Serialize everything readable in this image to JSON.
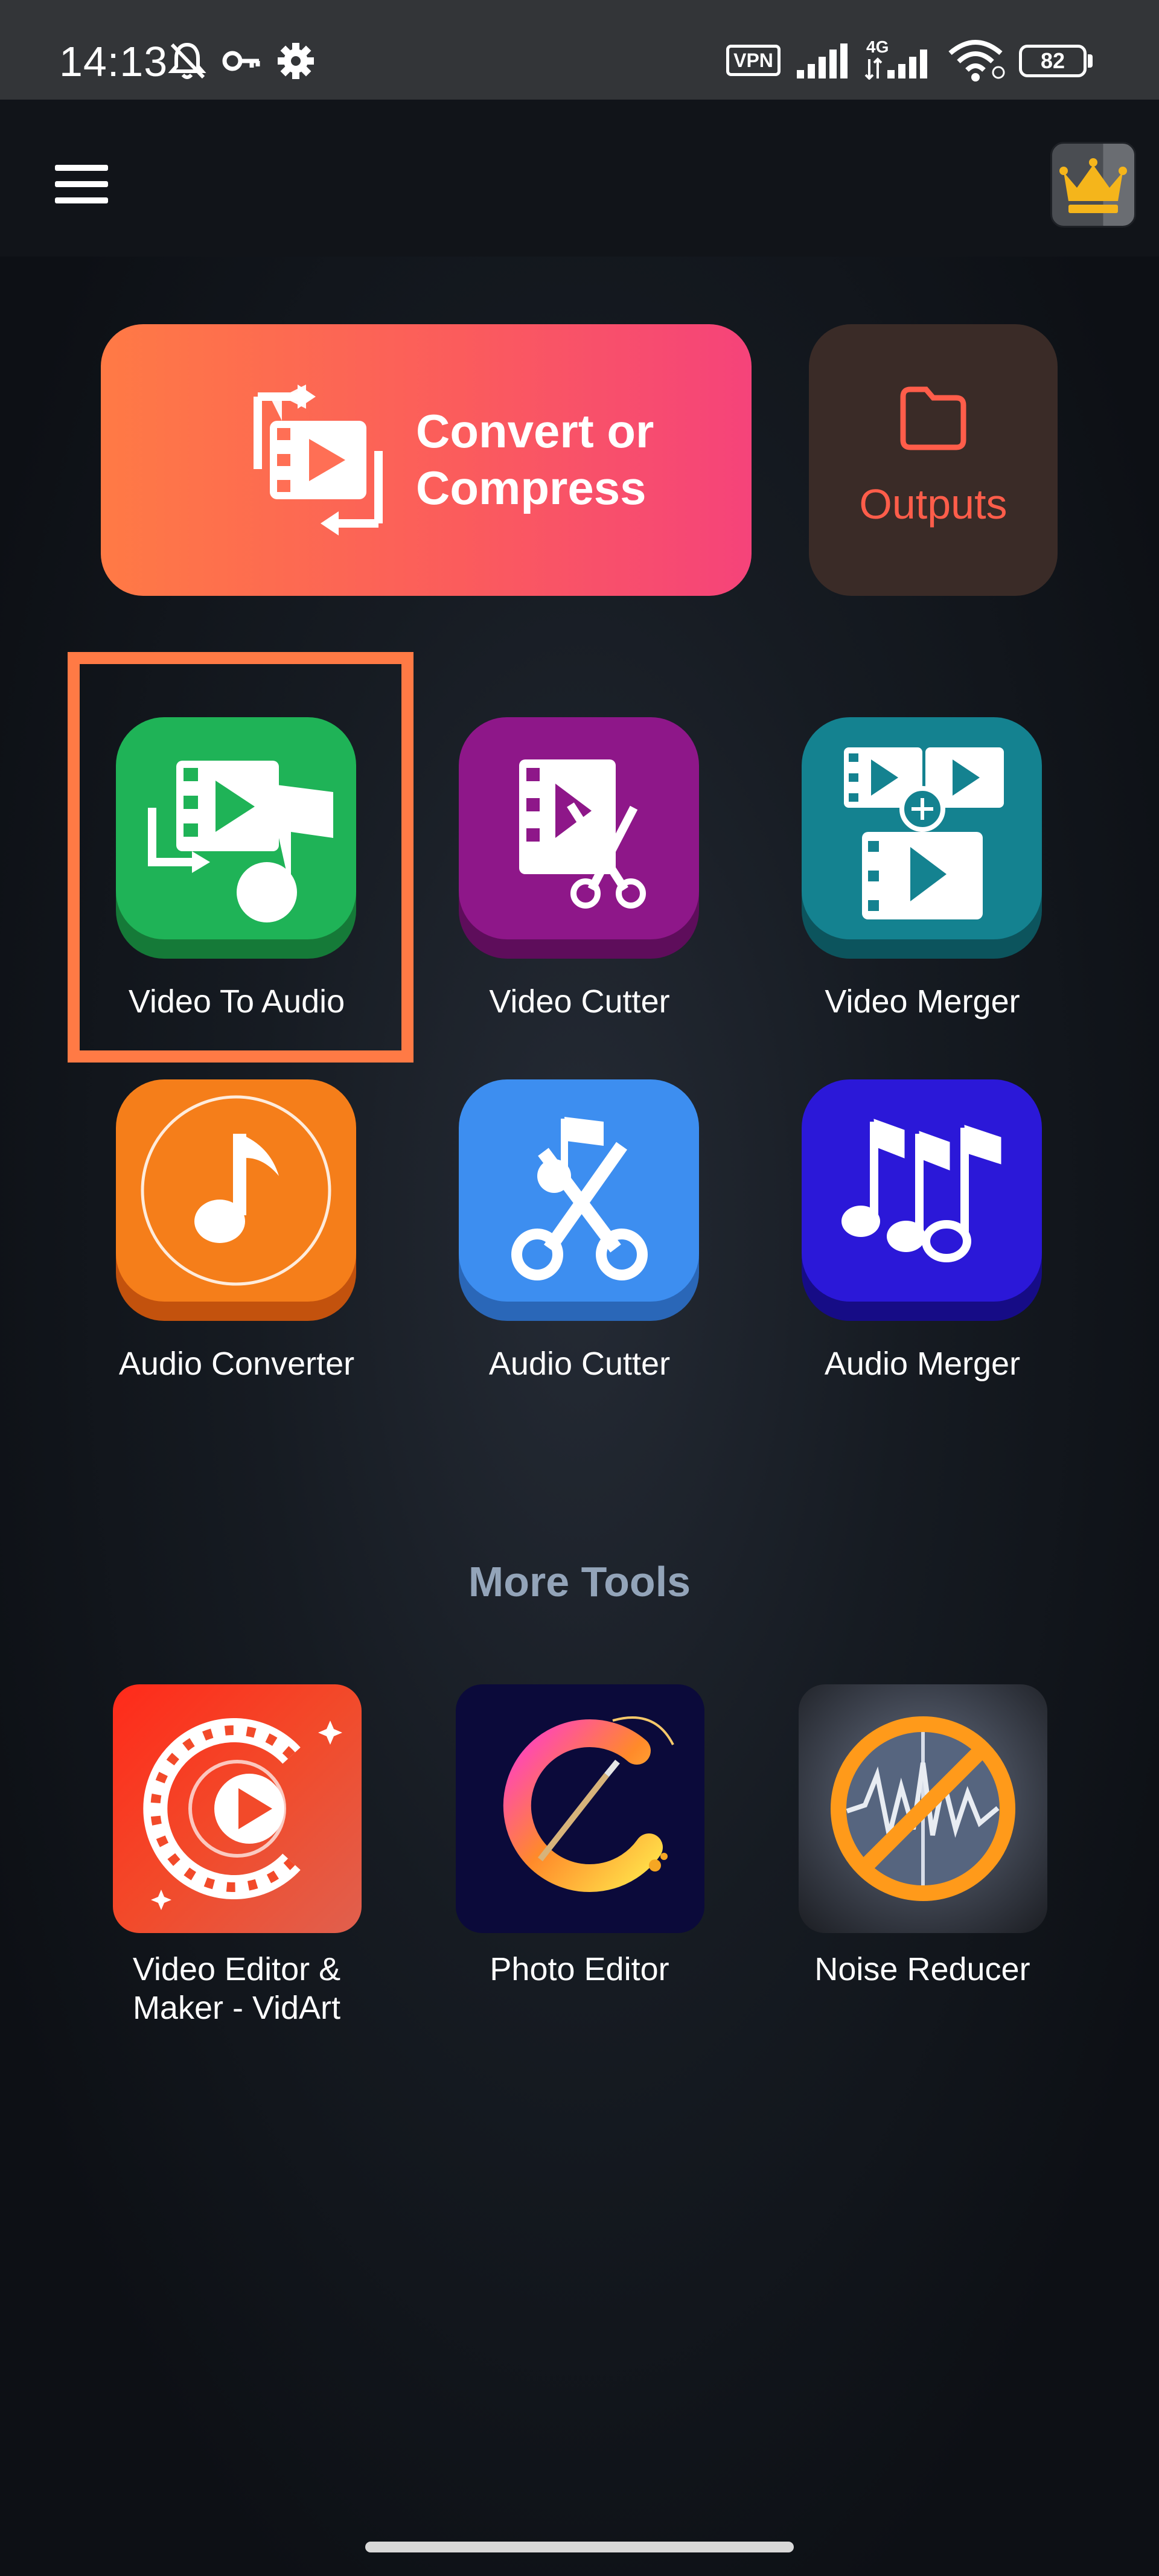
{
  "status_bar": {
    "time": "14:13",
    "vpn": "VPN",
    "network": "4G",
    "battery": "82"
  },
  "header": {
    "menu_icon": "hamburger-menu-icon",
    "premium_icon": "crown-icon"
  },
  "actions": {
    "convert_label_line1": "Convert or",
    "convert_label_line2": "Compress",
    "outputs_label": "Outputs"
  },
  "tools": [
    {
      "label": "Video To Audio",
      "icon": "video-to-audio-icon",
      "color": "#1fa84f",
      "highlighted": true
    },
    {
      "label": "Video Cutter",
      "icon": "video-cutter-icon",
      "color": "#8c1585"
    },
    {
      "label": "Video Merger",
      "icon": "video-merger-icon",
      "color": "#137d8a"
    },
    {
      "label": "Audio Converter",
      "icon": "audio-converter-icon",
      "color": "#f57c17"
    },
    {
      "label": "Audio Cutter",
      "icon": "audio-cutter-icon",
      "color": "#3d8ef0"
    },
    {
      "label": "Audio Merger",
      "icon": "audio-merger-icon",
      "color": "#2a17d6"
    }
  ],
  "more_tools": {
    "title": "More Tools",
    "items": [
      {
        "line1": "Video Editor &",
        "line2": "Maker - VidArt",
        "icon": "vidart-app-icon"
      },
      {
        "line1": "Photo Editor",
        "line2": "",
        "icon": "photo-editor-app-icon"
      },
      {
        "line1": "Noise Reducer",
        "line2": "",
        "icon": "noise-reducer-app-icon"
      }
    ]
  },
  "colors": {
    "accent_orange": "#ff7a45",
    "accent_pink": "#f5437a",
    "outputs_text": "#ff5d4a",
    "more_tools_title": "#93a4b9"
  }
}
